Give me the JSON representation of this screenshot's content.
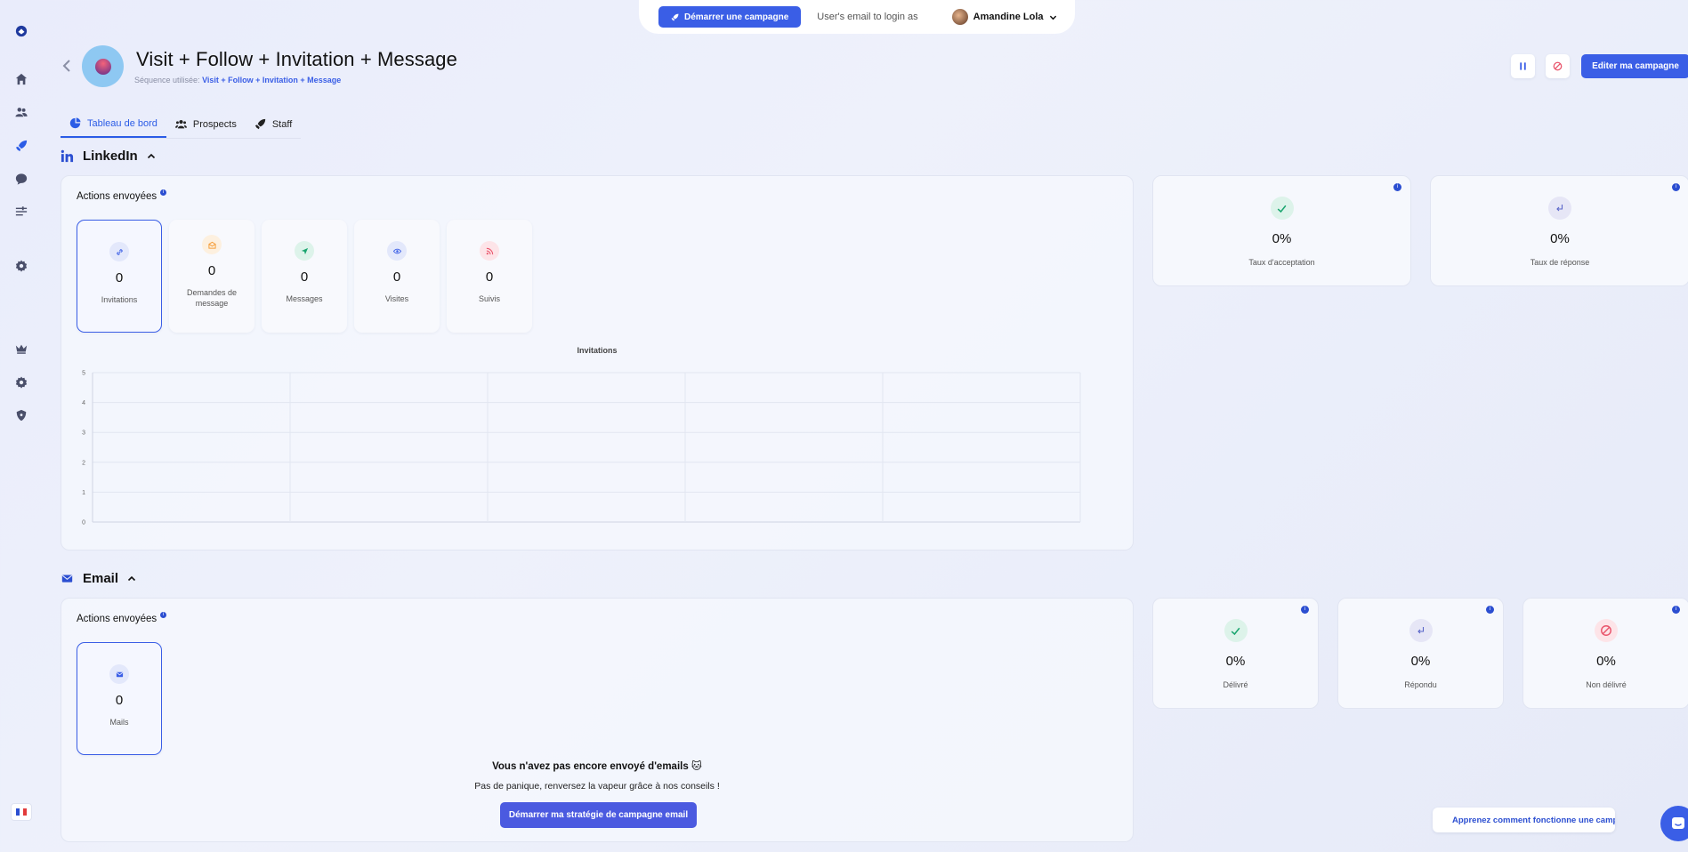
{
  "topbar": {
    "start_campaign_label": "Démarrer une campagne",
    "login_as_label": "User's email to login as",
    "user_name": "Amandine Lola"
  },
  "header": {
    "title": "Visit + Follow + Invitation + Message",
    "sequence_prefix": "Séquence utilisée:",
    "sequence_name": "Visit + Follow + Invitation + Message",
    "edit_label": "Editer ma campagne"
  },
  "tabs": [
    {
      "label": "Tableau de bord",
      "active": true
    },
    {
      "label": "Prospects",
      "active": false
    },
    {
      "label": "Staff",
      "active": false
    }
  ],
  "linkedin": {
    "section_label": "LinkedIn",
    "actions_title": "Actions envoyées",
    "stats": [
      {
        "value": "0",
        "label": "Invitations",
        "icon": "link-icon",
        "color": "#3a5ee6"
      },
      {
        "value": "0",
        "label": "Demandes de message",
        "icon": "envelope-open-icon",
        "color": "#f59e3b"
      },
      {
        "value": "0",
        "label": "Messages",
        "icon": "send-icon",
        "color": "#1aa56f"
      },
      {
        "value": "0",
        "label": "Visites",
        "icon": "eye-icon",
        "color": "#3a5ee6"
      },
      {
        "value": "0",
        "label": "Suivis",
        "icon": "rss-icon",
        "color": "#e9546b"
      }
    ],
    "rates": [
      {
        "value": "0%",
        "label": "Taux d'acceptation",
        "icon": "check-icon"
      },
      {
        "value": "0%",
        "label": "Taux de réponse",
        "icon": "reply-icon"
      }
    ]
  },
  "chart_data": {
    "type": "line",
    "title": "Invitations",
    "x": [
      "",
      "",
      "",
      "",
      ""
    ],
    "series": [
      {
        "values": []
      }
    ],
    "ylim": [
      0,
      5
    ],
    "yticks": [
      "0",
      "1",
      "2",
      "3",
      "4",
      "5"
    ],
    "grid": true
  },
  "email": {
    "section_label": "Email",
    "actions_title": "Actions envoyées",
    "stats": [
      {
        "value": "0",
        "label": "Mails",
        "icon": "mail-icon",
        "color": "#3a5ee6"
      }
    ],
    "rates": [
      {
        "value": "0%",
        "label": "Délivré",
        "icon": "check-icon"
      },
      {
        "value": "0%",
        "label": "Répondu",
        "icon": "reply-icon"
      },
      {
        "value": "0%",
        "label": "Non délivré",
        "icon": "ban-icon"
      }
    ],
    "empty_title": "Vous n'avez pas encore envoyé d'emails 🐱",
    "empty_text": "Pas de panique, renversez la vapeur grâce à nos conseils !",
    "cta_label": "Démarrer ma stratégie de campagne email"
  },
  "help": {
    "label": "Apprenez comment fonctionne une campagne !"
  },
  "colors": {
    "accent": "#3a5ee6",
    "check": "#1aa56f",
    "danger": "#e9546b"
  }
}
